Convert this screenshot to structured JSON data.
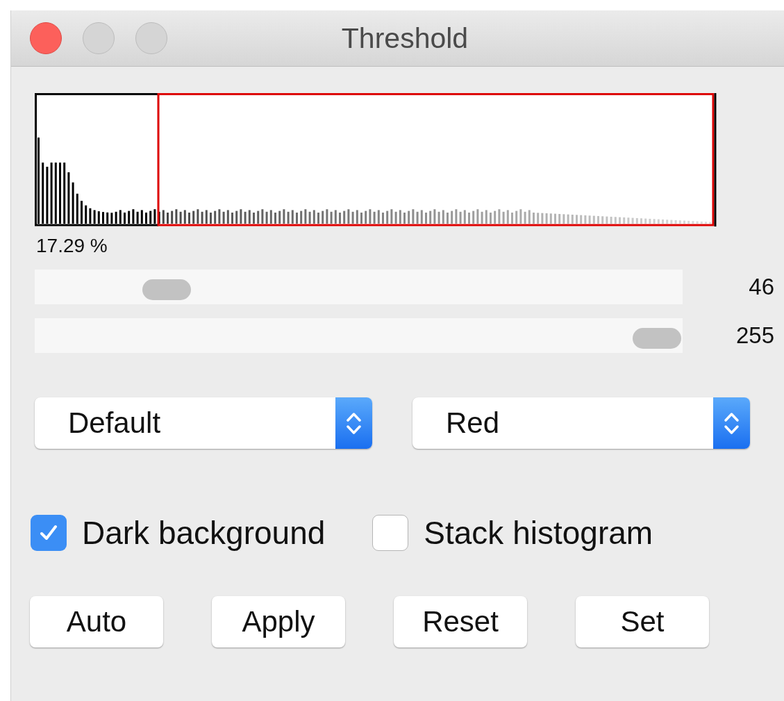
{
  "window": {
    "title": "Threshold"
  },
  "histogram": {
    "kind": "picture",
    "percentage": "17.29 %"
  },
  "sliders": [
    {
      "level": 0.18,
      "reading": "46"
    },
    {
      "level": 1,
      "reading": "255"
    }
  ],
  "dropdowns": [
    {
      "value": "Default"
    },
    {
      "value": "Red"
    }
  ],
  "checkboxes": [
    {
      "label": "Dark background",
      "checked": true
    },
    {
      "label": "Stack histogram",
      "checked": false
    }
  ],
  "buttons": [
    "Auto",
    "Apply",
    "Reset",
    "Set"
  ]
}
